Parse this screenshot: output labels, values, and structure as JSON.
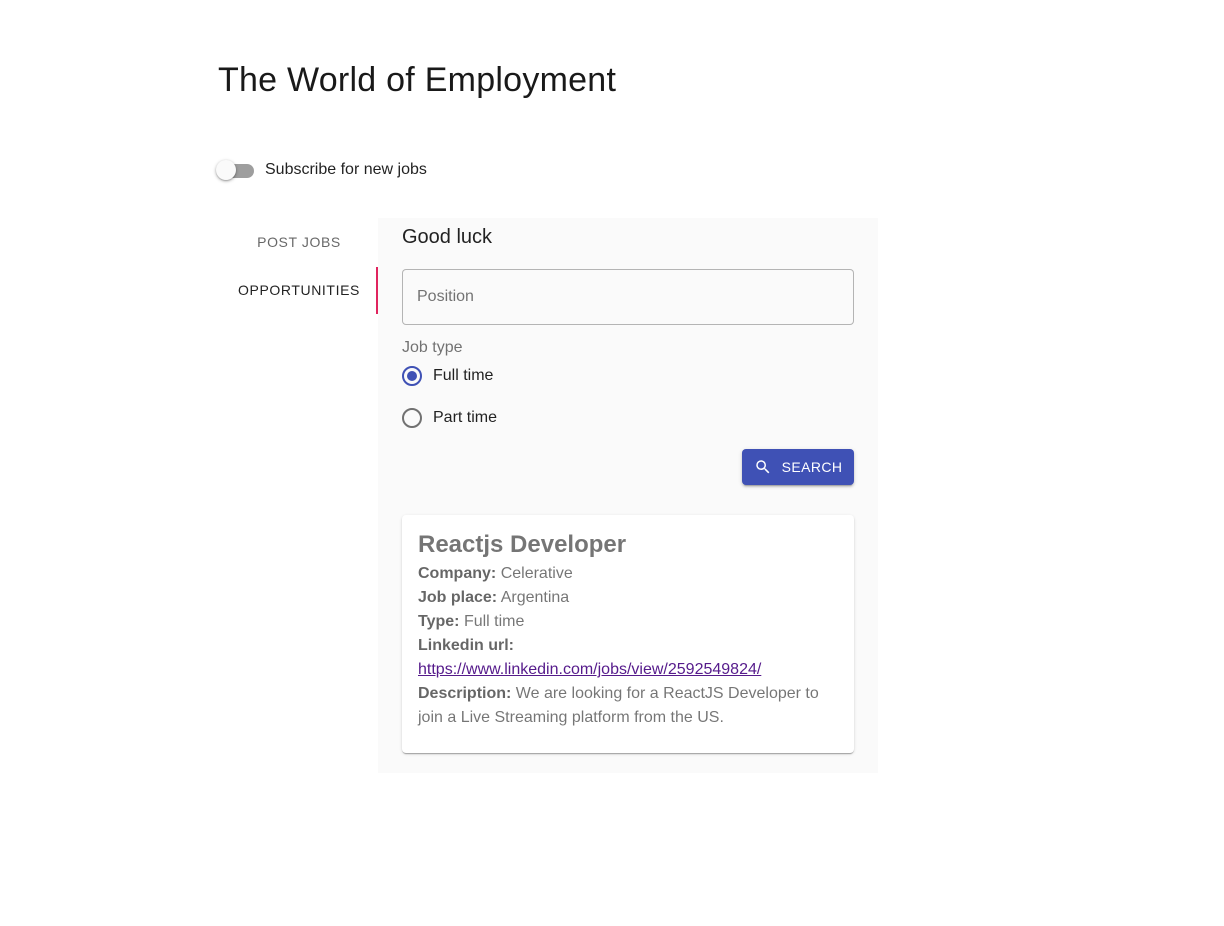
{
  "header": {
    "title": "The World of Employment"
  },
  "subscribe": {
    "label": "Subscribe for new jobs",
    "enabled": false
  },
  "tabs": [
    {
      "label": "POST JOBS",
      "active": false
    },
    {
      "label": "OPPORTUNITIES",
      "active": true
    }
  ],
  "panel": {
    "heading": "Good luck",
    "position_field": {
      "placeholder": "Position",
      "value": ""
    },
    "job_type": {
      "label": "Job type",
      "options": [
        {
          "label": "Full time",
          "checked": true
        },
        {
          "label": "Part time",
          "checked": false
        }
      ]
    },
    "search_button": {
      "label": "SEARCH",
      "icon": "search-icon"
    }
  },
  "job": {
    "title": "Reactjs Developer",
    "company_label": "Company:",
    "company": "Celerative",
    "place_label": "Job place:",
    "place": "Argentina",
    "type_label": "Type:",
    "type": "Full time",
    "linkedin_label": "Linkedin url:",
    "linkedin_url": "https://www.linkedin.com/jobs/view/2592549824/",
    "description_label": "Description:",
    "description": "We are looking for a ReactJS Developer to join a Live Streaming platform from the US."
  },
  "colors": {
    "primary": "#3f51b5",
    "tab_indicator": "#e0245e",
    "link": "#551a8b",
    "panel_background": "#fafafa"
  }
}
